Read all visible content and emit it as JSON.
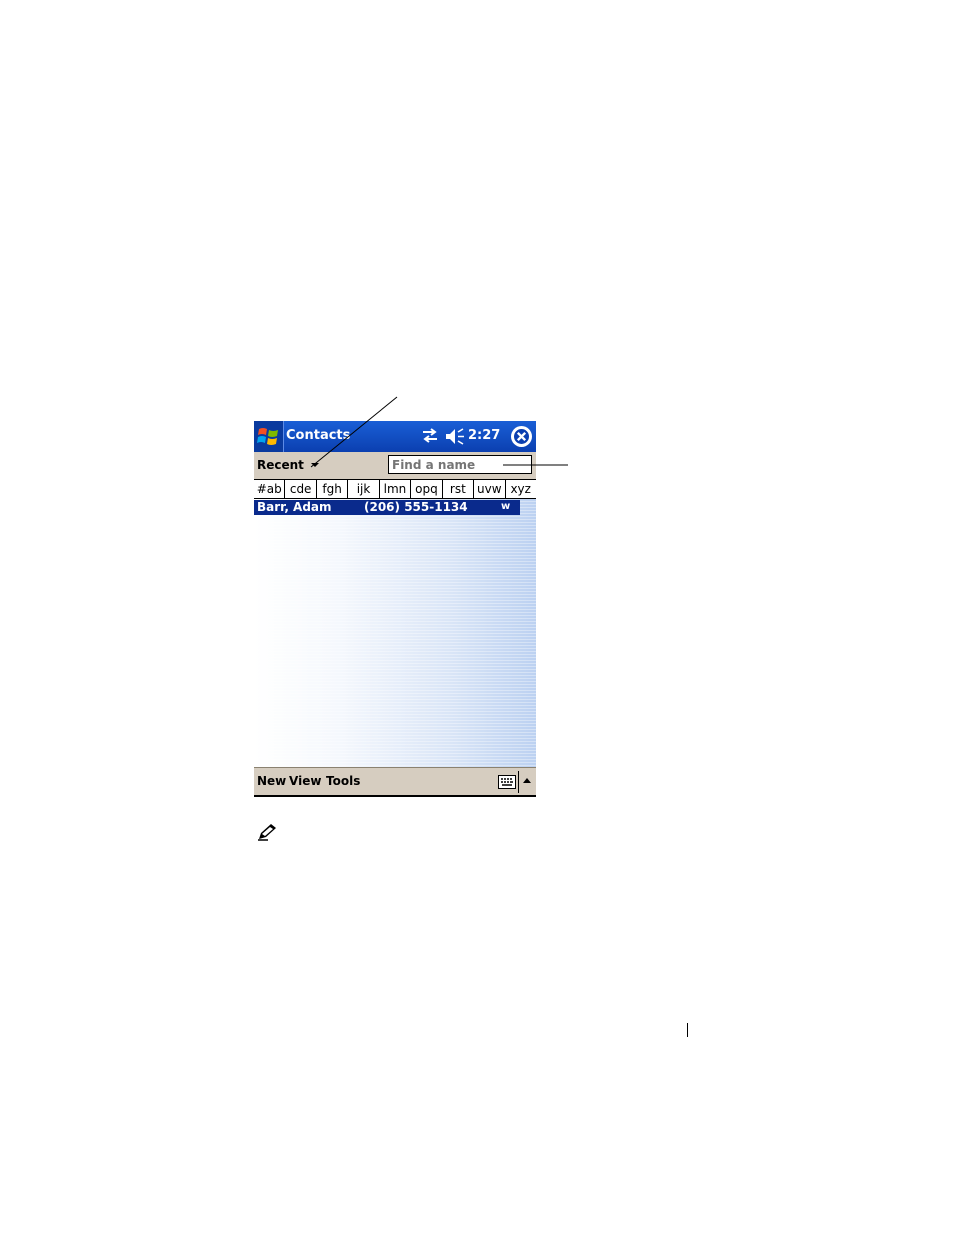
{
  "title_bar": {
    "app_title": "Contacts",
    "clock": "2:27",
    "icons": [
      "start-flag-icon",
      "connectivity-icon",
      "volume-icon",
      "close-icon"
    ]
  },
  "filter_bar": {
    "category": "Recent",
    "find_placeholder": "Find a name"
  },
  "letter_tabs": [
    "#ab",
    "cde",
    "fgh",
    "ijk",
    "lmn",
    "opq",
    "rst",
    "uvw",
    "xyz"
  ],
  "contacts": [
    {
      "name": "Barr, Adam",
      "phone": "(206) 555-1134",
      "type": "w",
      "selected": true
    }
  ],
  "command_bar": {
    "menus": [
      "New",
      "View",
      "Tools"
    ],
    "icons": [
      "keyboard-icon",
      "sip-up-arrow-icon"
    ]
  },
  "colors": {
    "title_bar": "#0b3fb0",
    "selection": "#0a2a8c",
    "bar_background": "#d6cdc0"
  }
}
